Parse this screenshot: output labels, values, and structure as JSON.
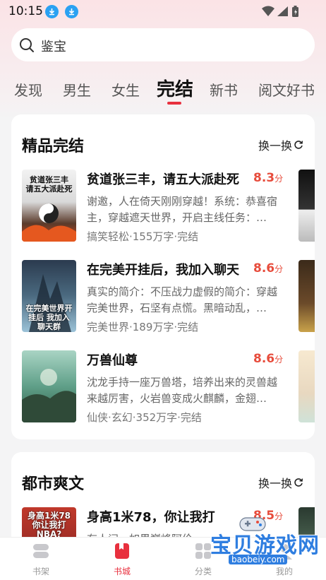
{
  "status": {
    "time": "10:15"
  },
  "search": {
    "text": "鉴宝"
  },
  "tabs": [
    "发现",
    "男生",
    "女生",
    "完结",
    "新书",
    "阅文好书"
  ],
  "section1": {
    "title": "精品完结",
    "refresh": "换一换",
    "books": [
      {
        "title": "贫道张三丰，请五大派赴死",
        "score": "8.3",
        "score_unit": "分",
        "desc": "谢邀，人在倚天刚刚穿越！系统：恭喜宿主，穿越遮天世界，开启主线任务：…",
        "meta": "搞笑轻松·155万字·完结",
        "cover_text": "贫道张三丰 请五大派赴死"
      },
      {
        "title": "在完美开挂后，我加入聊天",
        "score": "8.6",
        "score_unit": "分",
        "desc": "真实的简介：不压战力虚假的简介：穿越完美世界，石坚有点慌。黑暗动乱，…",
        "meta": "完美世界·189万字·完结",
        "cover_text": "在完美世界开挂后 我加入聊天群"
      },
      {
        "title": "万兽仙尊",
        "score": "8.6",
        "score_unit": "分",
        "desc": "沈龙手持一座万兽塔，培养出来的灵兽越来越厉害，火岩兽变成火麒麟，金翅…",
        "meta": "仙侠·玄幻·352万字·完结",
        "cover_text": ""
      }
    ]
  },
  "section2": {
    "title": "都市爽文",
    "refresh": "换一换",
    "books": [
      {
        "title": "身高1米78，你让我打",
        "score": "8.5",
        "score_unit": "分",
        "desc": "有人问，如果巅峰阿伦 …",
        "cover_text": "身高1米78 你让我打NBA?"
      }
    ]
  },
  "nav": [
    {
      "label": "书架"
    },
    {
      "label": "书城"
    },
    {
      "label": "分类"
    },
    {
      "label": "我的"
    }
  ],
  "watermark": {
    "text": "宝贝游戏网",
    "url": "baobeiy.com"
  },
  "colors": {
    "accent": "#e8303e",
    "score": "#e74c3c"
  }
}
